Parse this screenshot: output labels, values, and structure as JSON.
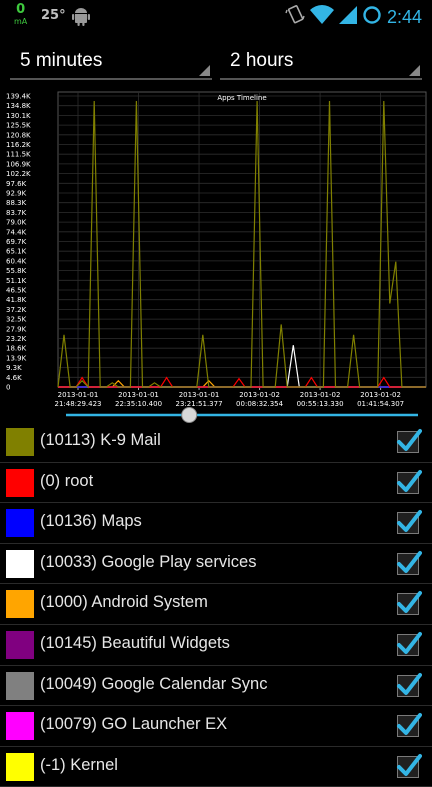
{
  "status_bar": {
    "data_rate": "0",
    "data_unit": "mA",
    "temperature": "25°",
    "time": "2:44",
    "icons": [
      "android-icon",
      "vibrate-icon",
      "wifi-icon",
      "signal-icon",
      "sync-icon"
    ]
  },
  "filters": {
    "time_window": "5 minutes",
    "time_range": "2 hours"
  },
  "chart_data": {
    "type": "line",
    "title": "Apps Timeline",
    "y_tick_labels": [
      "139.4K",
      "134.8K",
      "130.1K",
      "125.5K",
      "120.8K",
      "116.2K",
      "111.5K",
      "106.9K",
      "102.2K",
      "97.6K",
      "92.9K",
      "88.3K",
      "83.7K",
      "79.0K",
      "74.4K",
      "69.7K",
      "65.1K",
      "60.4K",
      "55.8K",
      "51.1K",
      "46.5K",
      "41.8K",
      "37.2K",
      "32.5K",
      "27.9K",
      "23.2K",
      "18.6K",
      "13.9K",
      "9.3K",
      "4.6K",
      "0"
    ],
    "ylim": [
      0,
      139400
    ],
    "x_tick_labels": [
      {
        "date": "2013-01-01",
        "time": "21:48:29.423"
      },
      {
        "date": "2013-01-01",
        "time": "22:35:10.400"
      },
      {
        "date": "2013-01-01",
        "time": "23:21:51.377"
      },
      {
        "date": "2013-01-02",
        "time": "00:08:32.354"
      },
      {
        "date": "2013-01-02",
        "time": "00:55:13.330"
      },
      {
        "date": "2013-01-02",
        "time": "01:41:54.307"
      }
    ],
    "series": [
      {
        "name": "(10113) K-9 Mail",
        "color": "#808000",
        "values": [
          0,
          25000,
          0,
          0,
          3000,
          0,
          137000,
          0,
          0,
          2000,
          0,
          0,
          0,
          137000,
          0,
          0,
          2000,
          0,
          0,
          0,
          0,
          0,
          0,
          0,
          25000,
          0,
          0,
          0,
          0,
          0,
          0,
          0,
          0,
          137000,
          0,
          0,
          0,
          30000,
          0,
          0,
          0,
          0,
          0,
          0,
          0,
          137000,
          0,
          0,
          0,
          25000,
          0,
          0,
          0,
          0,
          137000,
          40000,
          60000,
          0,
          0,
          0,
          0,
          0
        ]
      },
      {
        "name": "(0) root",
        "color": "#ff0000",
        "values": [
          0,
          0,
          0,
          0,
          4500,
          0,
          0,
          0,
          0,
          0,
          0,
          0,
          0,
          0,
          0,
          0,
          0,
          0,
          4500,
          0,
          0,
          0,
          0,
          0,
          0,
          0,
          0,
          0,
          0,
          0,
          4000,
          0,
          0,
          0,
          0,
          0,
          0,
          0,
          0,
          0,
          0,
          0,
          4500,
          0,
          0,
          0,
          0,
          0,
          0,
          0,
          0,
          0,
          0,
          0,
          4500,
          0,
          0,
          0,
          0,
          0,
          0,
          0
        ]
      },
      {
        "name": "(10136) Maps",
        "color": "#0000ff",
        "values": [
          0,
          0,
          0,
          0,
          0,
          0,
          0,
          0,
          0,
          0,
          0,
          0,
          0,
          0,
          0,
          0,
          0,
          0,
          0,
          0,
          0,
          0,
          0,
          0,
          0,
          0,
          0,
          0,
          0,
          0,
          0,
          0,
          0,
          0,
          0,
          0,
          0,
          0,
          0,
          0,
          0,
          0,
          0,
          0,
          0,
          0,
          0,
          0,
          0,
          0,
          0,
          0,
          0,
          0,
          0,
          0,
          0,
          0,
          0,
          0,
          0,
          0
        ]
      },
      {
        "name": "(10033) Google Play services",
        "color": "#ffffff",
        "values": [
          0,
          0,
          0,
          0,
          0,
          0,
          0,
          0,
          0,
          0,
          0,
          0,
          0,
          0,
          0,
          0,
          0,
          0,
          0,
          0,
          0,
          0,
          0,
          0,
          0,
          0,
          0,
          0,
          0,
          0,
          0,
          0,
          0,
          0,
          0,
          0,
          0,
          0,
          0,
          20000,
          0,
          0,
          0,
          0,
          0,
          0,
          0,
          0,
          0,
          0,
          0,
          0,
          0,
          0,
          0,
          0,
          0,
          0,
          0,
          0,
          0,
          0
        ]
      },
      {
        "name": "(1000) Android System",
        "color": "#ffa500",
        "values": [
          0,
          0,
          0,
          0,
          0,
          0,
          0,
          0,
          0,
          0,
          3000,
          0,
          0,
          0,
          0,
          0,
          0,
          0,
          0,
          0,
          0,
          0,
          0,
          0,
          0,
          3000,
          0,
          0,
          0,
          0,
          0,
          0,
          0,
          0,
          0,
          0,
          0,
          0,
          0,
          0,
          0,
          0,
          0,
          0,
          0,
          0,
          0,
          0,
          0,
          0,
          0,
          0,
          0,
          0,
          0,
          0,
          0,
          0,
          0,
          0,
          0,
          0
        ]
      },
      {
        "name": "(10145) Beautiful Widgets",
        "color": "#800080",
        "values": [
          0,
          0,
          0,
          0,
          0,
          0,
          0,
          0,
          0,
          0,
          0,
          0,
          0,
          0,
          0,
          0,
          0,
          0,
          0,
          0,
          0,
          0,
          0,
          0,
          0,
          0,
          0,
          0,
          0,
          0,
          0,
          0,
          0,
          0,
          0,
          0,
          0,
          0,
          0,
          0,
          0,
          0,
          0,
          0,
          0,
          0,
          0,
          0,
          0,
          0,
          0,
          0,
          0,
          0,
          0,
          0,
          0,
          0,
          0,
          0,
          0,
          0
        ]
      },
      {
        "name": "(10049) Google Calendar Sync",
        "color": "#808080",
        "values": [
          0,
          0,
          0,
          0,
          0,
          0,
          0,
          0,
          0,
          0,
          0,
          0,
          0,
          0,
          0,
          0,
          0,
          0,
          0,
          0,
          0,
          0,
          0,
          0,
          0,
          0,
          0,
          0,
          0,
          0,
          0,
          0,
          0,
          0,
          0,
          0,
          0,
          0,
          0,
          0,
          0,
          0,
          0,
          0,
          0,
          0,
          0,
          0,
          0,
          0,
          0,
          0,
          0,
          0,
          0,
          0,
          0,
          0,
          0,
          0,
          0,
          0
        ]
      },
      {
        "name": "(10079) GO Launcher EX",
        "color": "#ff00ff",
        "values": [
          0,
          0,
          0,
          0,
          0,
          0,
          0,
          0,
          0,
          0,
          0,
          0,
          0,
          0,
          0,
          0,
          0,
          0,
          0,
          0,
          0,
          0,
          0,
          0,
          0,
          0,
          0,
          0,
          0,
          0,
          0,
          0,
          0,
          0,
          0,
          0,
          0,
          0,
          0,
          0,
          0,
          0,
          0,
          0,
          0,
          0,
          0,
          0,
          0,
          0,
          0,
          0,
          0,
          0,
          0,
          0,
          0,
          0,
          0,
          0,
          0,
          0
        ]
      },
      {
        "name": "(-1) Kernel",
        "color": "#ffff00",
        "values": [
          0,
          0,
          0,
          0,
          0,
          0,
          0,
          0,
          0,
          0,
          0,
          0,
          0,
          0,
          0,
          0,
          0,
          0,
          0,
          0,
          0,
          0,
          0,
          0,
          0,
          0,
          0,
          0,
          0,
          0,
          0,
          0,
          0,
          0,
          0,
          0,
          0,
          0,
          0,
          0,
          0,
          0,
          0,
          0,
          0,
          0,
          0,
          0,
          0,
          0,
          0,
          0,
          0,
          0,
          0,
          0,
          0,
          0,
          0,
          0,
          0,
          0
        ]
      }
    ],
    "grid": true
  },
  "seekbar": {
    "progress": 0.35
  },
  "apps": [
    {
      "label": "(10113) K-9 Mail",
      "color": "#808000",
      "checked": true
    },
    {
      "label": "(0) root",
      "color": "#ff0000",
      "checked": true
    },
    {
      "label": "(10136) Maps",
      "color": "#0000ff",
      "checked": true
    },
    {
      "label": "(10033) Google Play services",
      "color": "#ffffff",
      "checked": true
    },
    {
      "label": "(1000) Android System",
      "color": "#ffa500",
      "checked": true
    },
    {
      "label": "(10145) Beautiful Widgets",
      "color": "#800080",
      "checked": true
    },
    {
      "label": "(10049) Google Calendar Sync",
      "color": "#808080",
      "checked": true
    },
    {
      "label": "(10079) GO Launcher EX",
      "color": "#ff00ff",
      "checked": true
    },
    {
      "label": "(-1) Kernel",
      "color": "#ffff00",
      "checked": true
    }
  ]
}
